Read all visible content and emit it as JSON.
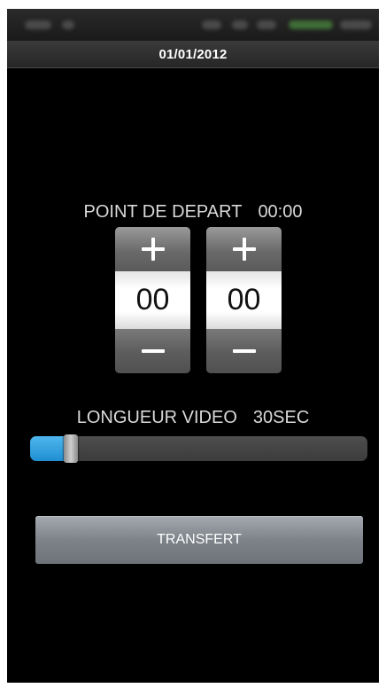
{
  "header": {
    "date": "01/01/2012"
  },
  "start_point": {
    "label": "POINT DE DEPART",
    "value": "00:00",
    "minutes": "00",
    "seconds": "00"
  },
  "video_length": {
    "label": "LONGUEUR VIDEO",
    "value": "30SEC",
    "slider_fraction": 0.1
  },
  "actions": {
    "transfer_label": "TRANSFERT"
  },
  "icons": {
    "increment": "plus-icon",
    "decrement": "minus-icon"
  },
  "colors": {
    "background": "#000000",
    "slider_fill": "#2a9de0",
    "button": "#8a9096"
  }
}
